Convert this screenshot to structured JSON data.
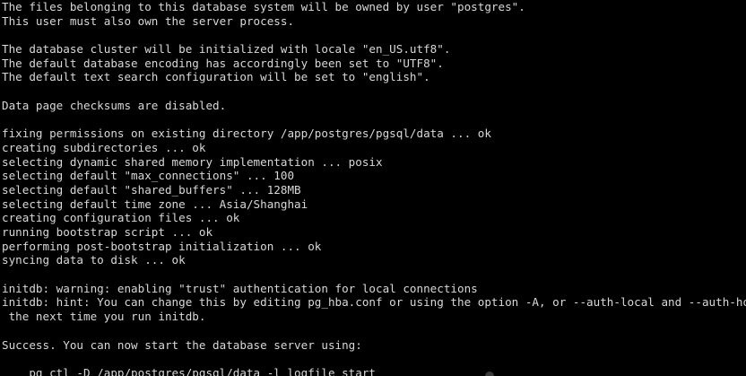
{
  "terminal": {
    "colors": {
      "background": "#000000",
      "foreground": "#d8d8d8"
    },
    "lines": [
      "The files belonging to this database system will be owned by user \"postgres\".",
      "This user must also own the server process.",
      "",
      "The database cluster will be initialized with locale \"en_US.utf8\".",
      "The default database encoding has accordingly been set to \"UTF8\".",
      "The default text search configuration will be set to \"english\".",
      "",
      "Data page checksums are disabled.",
      "",
      "fixing permissions on existing directory /app/postgres/pgsql/data ... ok",
      "creating subdirectories ... ok",
      "selecting dynamic shared memory implementation ... posix",
      "selecting default \"max_connections\" ... 100",
      "selecting default \"shared_buffers\" ... 128MB",
      "selecting default time zone ... Asia/Shanghai",
      "creating configuration files ... ok",
      "running bootstrap script ... ok",
      "performing post-bootstrap initialization ... ok",
      "syncing data to disk ... ok",
      "",
      "initdb: warning: enabling \"trust\" authentication for local connections",
      "initdb: hint: You can change this by editing pg_hba.conf or using the option -A, or --auth-local and --auth-host,",
      " the next time you run initdb.",
      "",
      "Success. You can now start the database server using:",
      "",
      "    pg_ctl -D /app/postgres/pgsql/data -l logfile start"
    ]
  }
}
